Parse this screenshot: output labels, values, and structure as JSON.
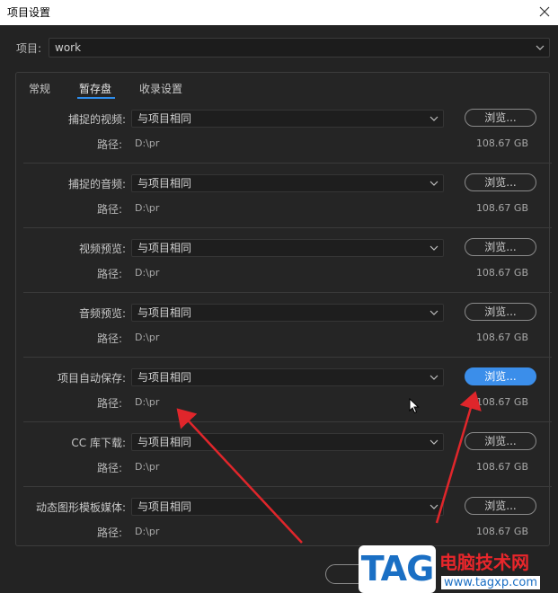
{
  "window": {
    "title": "项目设置"
  },
  "project": {
    "label": "项目:",
    "value": "work"
  },
  "tabs": [
    {
      "label": "常规",
      "active": false
    },
    {
      "label": "暂存盘",
      "active": true
    },
    {
      "label": "收录设置",
      "active": false
    }
  ],
  "rows": [
    {
      "label": "捕捉的视频:",
      "select": "与项目相同",
      "browse": "浏览...",
      "path_label": "路径:",
      "path": "D:\\pr",
      "size": "108.67 GB",
      "highlight": false
    },
    {
      "label": "捕捉的音频:",
      "select": "与项目相同",
      "browse": "浏览...",
      "path_label": "路径:",
      "path": "D:\\pr",
      "size": "108.67 GB",
      "highlight": false
    },
    {
      "label": "视频预览:",
      "select": "与项目相同",
      "browse": "浏览...",
      "path_label": "路径:",
      "path": "D:\\pr",
      "size": "108.67 GB",
      "highlight": false
    },
    {
      "label": "音频预览:",
      "select": "与项目相同",
      "browse": "浏览...",
      "path_label": "路径:",
      "path": "D:\\pr",
      "size": "108.67 GB",
      "highlight": false
    },
    {
      "label": "项目自动保存:",
      "select": "与项目相同",
      "browse": "浏览...",
      "path_label": "路径:",
      "path": "D:\\pr",
      "size": "108.67 GB",
      "highlight": true
    },
    {
      "label": "CC 库下载:",
      "select": "与项目相同",
      "browse": "浏览...",
      "path_label": "路径:",
      "path": "D:\\pr",
      "size": "108.67 GB",
      "highlight": false
    },
    {
      "label": "动态图形模板媒体:",
      "select": "与项目相同",
      "browse": "浏览...",
      "path_label": "路径:",
      "path": "D:\\pr",
      "size": "108.67 GB",
      "highlight": false
    }
  ],
  "colors": {
    "accent": "#3b8eea",
    "arrow": "#e0262b",
    "background": "#232323"
  },
  "watermark": {
    "logo": "TAG",
    "title": "电脑技术网",
    "url": "www.tagxp.com"
  }
}
